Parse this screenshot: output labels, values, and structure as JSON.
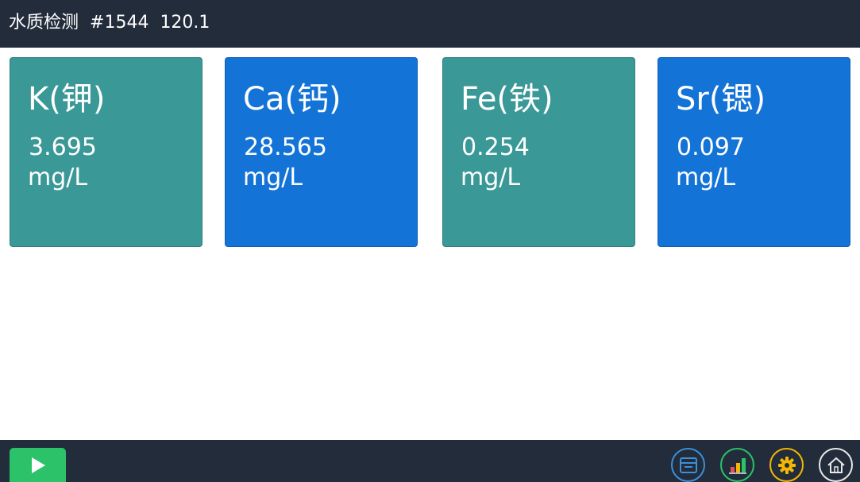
{
  "header": {
    "title": "水质检测",
    "device_id": "#1544",
    "reading": "120.1"
  },
  "cards": [
    {
      "name": "K(钾)",
      "value": "3.695",
      "unit": "mg/L",
      "color": "#3a9896"
    },
    {
      "name": "Ca(钙)",
      "value": "28.565",
      "unit": "mg/L",
      "color": "#1473d6"
    },
    {
      "name": "Fe(铁)",
      "value": "0.254",
      "unit": "mg/L",
      "color": "#3a9896"
    },
    {
      "name": "Sr(锶)",
      "value": "0.097",
      "unit": "mg/L",
      "color": "#1473d6"
    }
  ],
  "toolbar": {
    "play_color": "#2bc26a",
    "icons": [
      {
        "icon": "archive-icon",
        "color": "#3d8fd6"
      },
      {
        "icon": "bar-chart-icon",
        "color": "#2bc26a"
      },
      {
        "icon": "gear-icon",
        "color": "#f2b705"
      },
      {
        "icon": "home-icon",
        "color": "#e8e8e8"
      }
    ]
  }
}
